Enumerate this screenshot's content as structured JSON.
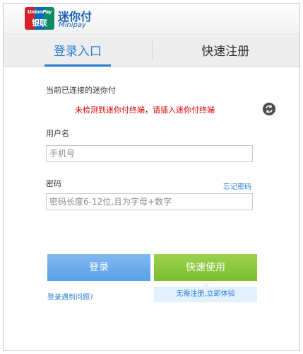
{
  "header": {
    "logo_line1": "UnionPay",
    "logo_line2": "银联",
    "brand_name": "迷你付",
    "brand_sub": "Minipay"
  },
  "tabs": {
    "login": "登录入口",
    "register": "快速注册"
  },
  "form": {
    "connection_label": "当前已连接的迷你付",
    "warning": "未检测到迷你付终端，请插入迷你付终端",
    "username_label": "用户名",
    "username_placeholder": "手机号",
    "password_label": "密码",
    "forgot_password": "忘记密码",
    "password_placeholder": "密码长度6-12位,且为字母+数字"
  },
  "buttons": {
    "login": "登录",
    "quick_use": "快速使用"
  },
  "links": {
    "login_problem": "登录遇到问题?",
    "quick_tip": "无需注册,立即体验"
  },
  "colors": {
    "accent_blue": "#2b7fd6",
    "warning_red": "#d40000",
    "login_button": "#5aa0e6",
    "quick_button": "#7cbd2c"
  }
}
